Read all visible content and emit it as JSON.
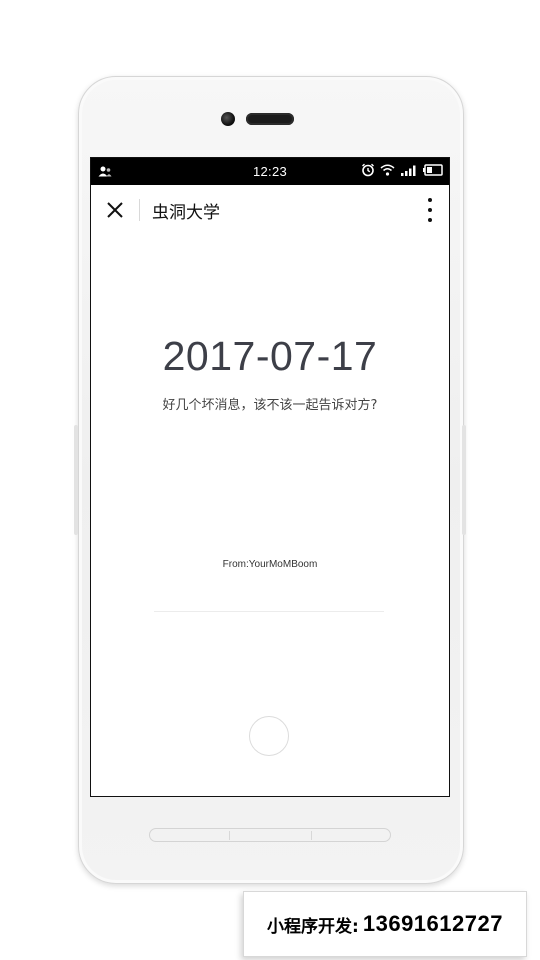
{
  "status_bar": {
    "time": "12:23"
  },
  "nav": {
    "title": "虫洞大学"
  },
  "content": {
    "date": "2017-07-17",
    "question": "好几个坏消息，该不该一起告诉对方?",
    "from": "From:YourMoMBoom"
  },
  "promo": {
    "label": "小程序开发:",
    "phone": "13691612727"
  },
  "icons": [
    "user-icon",
    "alarm-icon",
    "wifi-icon",
    "signal-icon",
    "battery-icon",
    "close-icon",
    "more-icon"
  ]
}
